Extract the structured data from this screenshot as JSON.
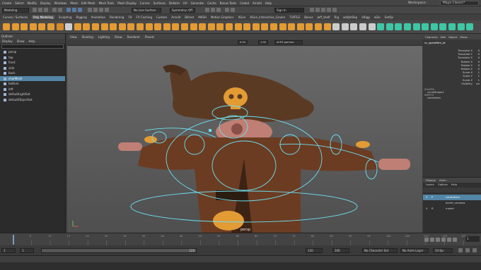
{
  "menubar": {
    "items": [
      "Create",
      "Select",
      "Modify",
      "Display",
      "Windows",
      "Mesh",
      "Edit Mesh",
      "Mesh Tools",
      "Mesh Display",
      "Curves",
      "Surfaces",
      "Deform",
      "UV",
      "Generate",
      "Cache",
      "Bonus Tools",
      "Coded",
      "Arnold",
      "Help"
    ],
    "workspace_label": "Workspace :",
    "workspace_value": "Maya Classic*"
  },
  "toolbar": {
    "mode_value": "Modeling",
    "live_surface": "No Live Surface",
    "symmetry": "Symmetry: Off",
    "sign_in": "Sign In"
  },
  "shelf": {
    "tabs": [
      "Curves / Surfaces",
      "Poly Modeling",
      "Sculpting",
      "Rigging",
      "Animation",
      "Rendering",
      "FX",
      "FX Caching",
      "Custom",
      "Arnold",
      "Bifrost",
      "MASH",
      "Motion Graphics",
      "XGen",
      "XGen_Interactive_Groom",
      "TURTLE",
      "Bonus",
      "Jeff_shelf",
      "Rig",
      "addJntSkp",
      "eRigg",
      "xGlo",
      "SetOp"
    ],
    "active_tab": "Poly Modeling"
  },
  "outliner": {
    "title": "Outliner",
    "menu": [
      "Display",
      "Show",
      "Help"
    ],
    "items": [
      "persp",
      "top",
      "front",
      "side",
      "back",
      "charMesh",
      "bottom",
      "left",
      "defaultLightSet",
      "defaultObjectSet"
    ],
    "selected_item": "charMesh"
  },
  "viewport": {
    "menu": [
      "View",
      "Shading",
      "Lighting",
      "Show",
      "Renderer",
      "Panels"
    ],
    "num1": "0.00",
    "num2": "1.00",
    "colorspace": "ACES gamma",
    "camera_label": "persp"
  },
  "channels": {
    "tabs": [
      "Channels",
      "Edit",
      "Object",
      "Show"
    ],
    "object_name": "cc_spineBtm_dr",
    "attributes": [
      {
        "label": "Translate X",
        "value": "0"
      },
      {
        "label": "Translate Y",
        "value": "0"
      },
      {
        "label": "Translate Z",
        "value": "0"
      },
      {
        "label": "Rotate X",
        "value": "0"
      },
      {
        "label": "Rotate Y",
        "value": "0"
      },
      {
        "label": "Rotate Z",
        "value": "0"
      },
      {
        "label": "Scale X",
        "value": "1"
      },
      {
        "label": "Scale Y",
        "value": "1"
      },
      {
        "label": "Scale Z",
        "value": "1"
      },
      {
        "label": "Visibility",
        "value": "on"
      }
    ],
    "shapes_header": "SHAPES",
    "shape_name": "curveShape1",
    "inputs_header": "INPUTS",
    "input_name": "controllers"
  },
  "layers": {
    "tabs": [
      "Display",
      "Anim"
    ],
    "menu": [
      "Layers",
      "Options",
      "Help"
    ],
    "rows": [
      {
        "v": "V",
        "p": "P",
        "name": "controllers",
        "selected": true
      },
      {
        "v": "",
        "p": "",
        "name": "bonfir_shadow",
        "selected": false
      },
      {
        "v": "V",
        "p": "R",
        "name": "model",
        "selected": false
      }
    ]
  },
  "timeline": {
    "ticks": [
      "5",
      "10",
      "15",
      "20",
      "25",
      "30",
      "35",
      "40",
      "45",
      "50",
      "55",
      "60",
      "65",
      "70",
      "75",
      "80",
      "85",
      "90",
      "95",
      "100",
      "105",
      "110",
      "115",
      "120"
    ],
    "current_frame": "1"
  },
  "range": {
    "start": "1",
    "playback_start": "1",
    "slider_label": "120",
    "playback_end": "120",
    "end": "200",
    "character_set": "No Character Set",
    "anim_layer": "No Anim Layer",
    "fps": "24 fps"
  },
  "colors": {
    "accent_orange": "#e39b34",
    "rig_cyan": "#6ee0f2",
    "select_blue": "#5285a6"
  }
}
